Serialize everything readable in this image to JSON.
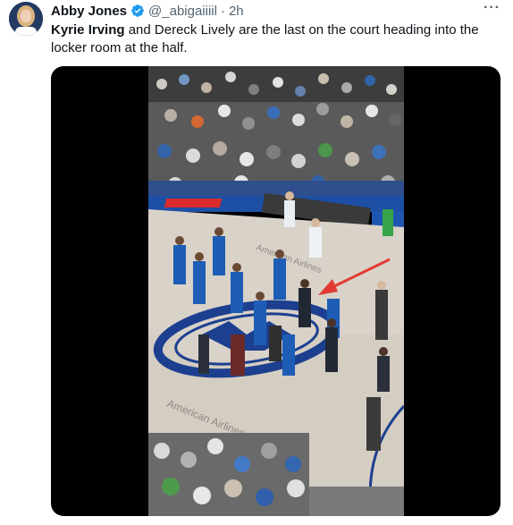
{
  "author": {
    "name": "Abby Jones",
    "handle": "@_abigaiiiil",
    "separator": "·",
    "time": "2h",
    "verified": true
  },
  "more_icon": "more-horizontal-icon",
  "tweet": {
    "text_bold": "Kyrie Irving",
    "text_rest": " and Dereck Lively are the last on the court heading into the locker room at the half."
  },
  "media": {
    "type": "video-frame",
    "floor_text_top": "American Airlines",
    "floor_text_bottom": "American Airlines",
    "arrow_color": "#e23b33"
  },
  "colors": {
    "verified": "#1d9bf0",
    "secondary_text": "#536471",
    "dallas_blue": "#1d5db5"
  }
}
